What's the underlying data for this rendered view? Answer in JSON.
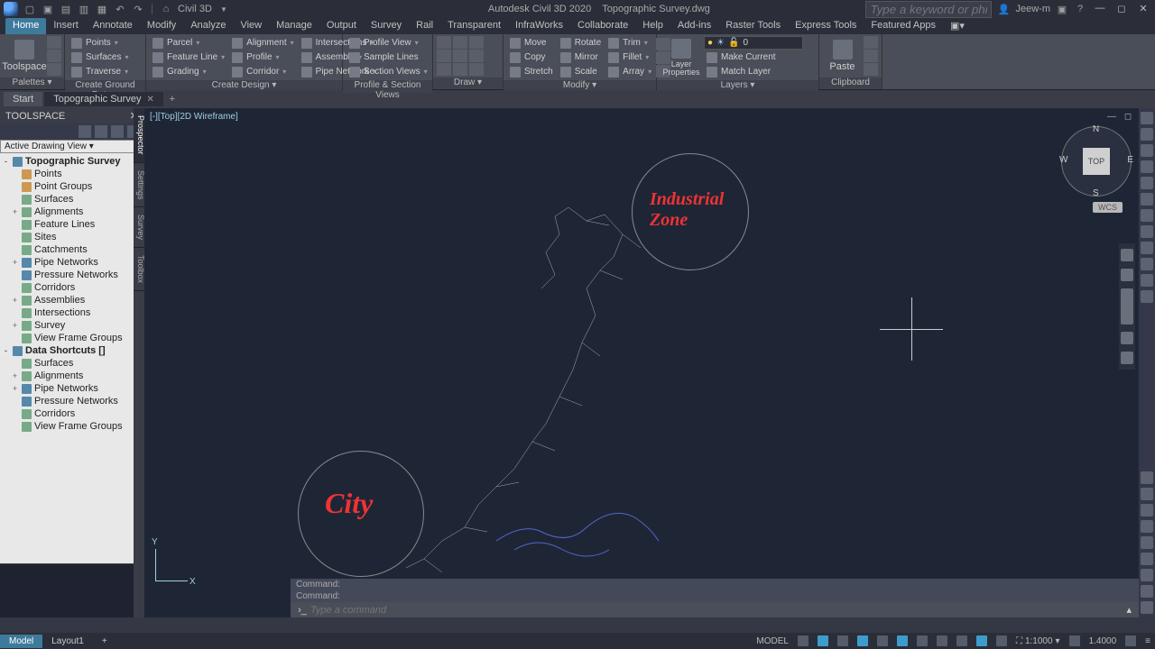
{
  "app": {
    "suite_label": "Civil 3D",
    "title": "Autodesk Civil 3D 2020",
    "document": "Topographic Survey.dwg",
    "search_placeholder": "Type a keyword or phrase",
    "user": "Jeew-m"
  },
  "menus": [
    "Home",
    "Insert",
    "Annotate",
    "Modify",
    "Analyze",
    "View",
    "Manage",
    "Output",
    "Survey",
    "Rail",
    "Transparent",
    "InfraWorks",
    "Collaborate",
    "Help",
    "Add-ins",
    "Raster Tools",
    "Express Tools",
    "Featured Apps"
  ],
  "ribbon": {
    "palettes": {
      "title": "Palettes ▾",
      "big": "Toolspace"
    },
    "ground": {
      "title": "Create Ground Data ▾",
      "items": [
        "Points",
        "Surfaces",
        "Traverse"
      ]
    },
    "design": {
      "title": "Create Design ▾",
      "col1": [
        "Parcel",
        "Feature Line",
        "Grading"
      ],
      "col2": [
        "Alignment",
        "Profile",
        "Corridor"
      ],
      "col3": [
        "Intersections",
        "Assembly",
        "Pipe Network"
      ]
    },
    "psv": {
      "title": "Profile & Section Views",
      "items": [
        "Profile View",
        "Sample Lines",
        "Section Views"
      ]
    },
    "draw": {
      "title": "Draw ▾"
    },
    "modify": {
      "title": "Modify ▾",
      "col1": [
        "Move",
        "Copy",
        "Stretch"
      ],
      "col2": [
        "Rotate",
        "Mirror",
        "Scale"
      ],
      "col3": [
        "Trim",
        "Fillet",
        "Array"
      ]
    },
    "layers": {
      "title": "Layers ▾",
      "big": "Layer Properties",
      "items": [
        "Make Current",
        "Match Layer"
      ],
      "combo": "0"
    },
    "clipboard": {
      "title": "Clipboard",
      "big": "Paste"
    }
  },
  "doc_tabs": {
    "start": "Start",
    "active": "Topographic Survey"
  },
  "toolspace": {
    "title": "TOOLSPACE",
    "view_select": "Active Drawing View",
    "side_tabs": [
      "Prospector",
      "Settings",
      "Survey",
      "Toolbox"
    ],
    "tree": [
      {
        "lvl": 0,
        "exp": "-",
        "label": "Topographic Survey",
        "bold": true,
        "cls": "blue"
      },
      {
        "lvl": 1,
        "exp": "",
        "label": "Points",
        "cls": "orange"
      },
      {
        "lvl": 1,
        "exp": "",
        "label": "Point Groups",
        "cls": "orange"
      },
      {
        "lvl": 1,
        "exp": "",
        "label": "Surfaces",
        "cls": ""
      },
      {
        "lvl": 1,
        "exp": "+",
        "label": "Alignments",
        "cls": ""
      },
      {
        "lvl": 1,
        "exp": "",
        "label": "Feature Lines",
        "cls": ""
      },
      {
        "lvl": 1,
        "exp": "",
        "label": "Sites",
        "cls": ""
      },
      {
        "lvl": 1,
        "exp": "",
        "label": "Catchments",
        "cls": ""
      },
      {
        "lvl": 1,
        "exp": "+",
        "label": "Pipe Networks",
        "cls": "blue"
      },
      {
        "lvl": 1,
        "exp": "",
        "label": "Pressure Networks",
        "cls": "blue"
      },
      {
        "lvl": 1,
        "exp": "",
        "label": "Corridors",
        "cls": ""
      },
      {
        "lvl": 1,
        "exp": "+",
        "label": "Assemblies",
        "cls": ""
      },
      {
        "lvl": 1,
        "exp": "",
        "label": "Intersections",
        "cls": ""
      },
      {
        "lvl": 1,
        "exp": "+",
        "label": "Survey",
        "cls": ""
      },
      {
        "lvl": 1,
        "exp": "",
        "label": "View Frame Groups",
        "cls": ""
      },
      {
        "lvl": 0,
        "exp": "-",
        "label": "Data Shortcuts []",
        "bold": true,
        "cls": "blue"
      },
      {
        "lvl": 1,
        "exp": "",
        "label": "Surfaces",
        "cls": ""
      },
      {
        "lvl": 1,
        "exp": "+",
        "label": "Alignments",
        "cls": ""
      },
      {
        "lvl": 1,
        "exp": "+",
        "label": "Pipe Networks",
        "cls": "blue"
      },
      {
        "lvl": 1,
        "exp": "",
        "label": "Pressure Networks",
        "cls": "blue"
      },
      {
        "lvl": 1,
        "exp": "",
        "label": "Corridors",
        "cls": ""
      },
      {
        "lvl": 1,
        "exp": "",
        "label": "View Frame Groups",
        "cls": ""
      }
    ]
  },
  "viewport": {
    "label": "[-][Top][2D Wireframe]",
    "annot1": "Industrial\nZone",
    "annot2": "City",
    "viewcube": {
      "top": "TOP",
      "n": "N",
      "s": "S",
      "e": "E",
      "w": "W"
    },
    "wcs": "WCS",
    "ucs": {
      "x": "X",
      "y": "Y"
    }
  },
  "cmd": {
    "hist1": "Command:",
    "hist2": "Command:",
    "placeholder": "Type a command"
  },
  "bottom": {
    "model": "Model",
    "layout": "Layout1",
    "status_model": "MODEL",
    "scale": "1:1000",
    "decimal": "1.4000"
  }
}
